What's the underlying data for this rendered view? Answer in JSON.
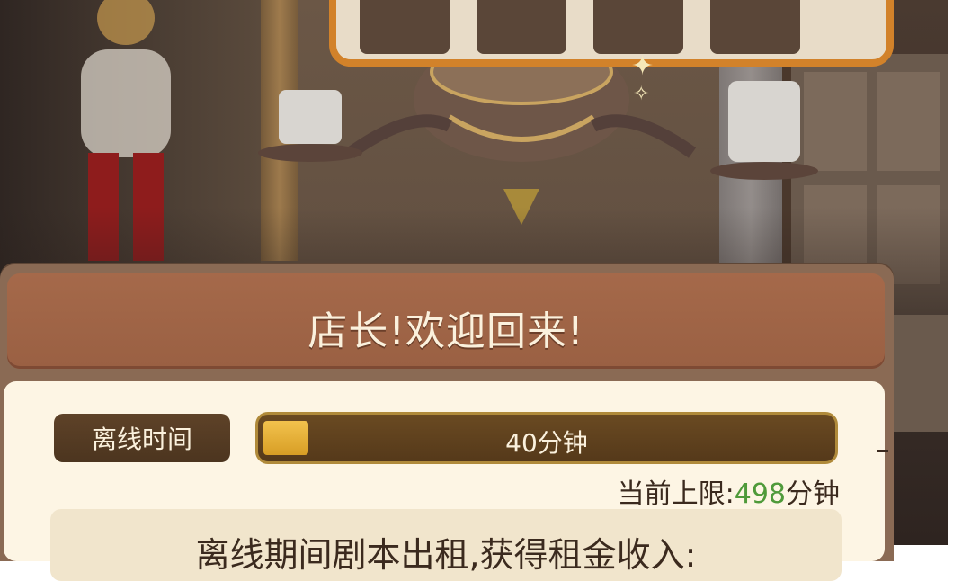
{
  "scene": {
    "sparkle_glyph": "✦",
    "sparkle_glyph_small": "✧"
  },
  "dialog": {
    "title": "店长!欢迎回来!",
    "offline_label": "离线时间",
    "offline_time": "40分钟",
    "offline_progress_fraction": 0.08,
    "limit_prefix": "当前上限:",
    "limit_value": "498",
    "limit_unit": "分钟",
    "info_text": "离线期间剧本出租,获得租金收入:"
  },
  "colors": {
    "header_bg": "#a5694a",
    "body_bg": "#fdf5e4",
    "progress_fill": "#f2c24d",
    "limit_value_green": "#4f9a3a",
    "text_dark": "#3b2a1e"
  }
}
